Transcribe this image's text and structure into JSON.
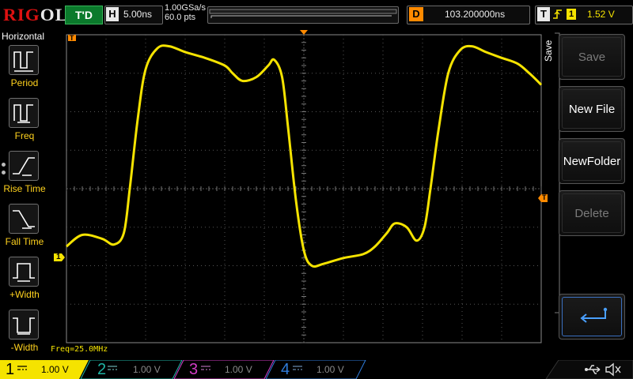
{
  "brand": {
    "logo_text_red": "RIG",
    "logo_text_white": "OL"
  },
  "top": {
    "trigger_status": "T'D",
    "h_key": "H",
    "timebase": "5.00ns",
    "sample_rate": "1.00GSa/s",
    "points": "60.0 pts",
    "delay_key": "D",
    "delay": "103.200000ns",
    "trig_key": "T",
    "trig_source": "1",
    "trig_level": "1.52 V"
  },
  "left_menu": {
    "title": "Horizontal",
    "items": [
      {
        "label": "Period",
        "icon": "period-icon"
      },
      {
        "label": "Freq",
        "icon": "freq-icon"
      },
      {
        "label": "Rise Time",
        "icon": "rise-time-icon"
      },
      {
        "label": "Fall Time",
        "icon": "fall-time-icon"
      },
      {
        "label": "+Width",
        "icon": "positive-width-icon"
      },
      {
        "label": "-Width",
        "icon": "negative-width-icon"
      }
    ]
  },
  "measurement": {
    "text": "Freq=25.0MHz"
  },
  "right_menu": {
    "title": "Save",
    "buttons": [
      {
        "label": "Save",
        "enabled": false
      },
      {
        "label": "New File",
        "enabled": true
      },
      {
        "label": "NewFolder",
        "enabled": true
      },
      {
        "label": "Delete",
        "enabled": false
      }
    ],
    "enter_icon": "enter-icon"
  },
  "markers": {
    "ch1_ground": "1",
    "trigger_marker": "T",
    "trig_level_marker": "T"
  },
  "channels": [
    {
      "num": "1",
      "scale": "1.00 V",
      "active": true,
      "color": "#f5e300"
    },
    {
      "num": "2",
      "scale": "1.00 V",
      "active": false,
      "color": "#1fb6a6"
    },
    {
      "num": "3",
      "scale": "1.00 V",
      "active": false,
      "color": "#d43cc6"
    },
    {
      "num": "4",
      "scale": "1.00 V",
      "active": false,
      "color": "#2f7ddc"
    }
  ],
  "colors": {
    "waveform": "#f5e300",
    "trigger_marker": "#ff8a00",
    "grid": "#8a8a8a",
    "status_green": "#0b7a2c"
  },
  "waveform_data": {
    "note_units": "screen divisions",
    "h_divisions": 12,
    "v_divisions": 8
  }
}
